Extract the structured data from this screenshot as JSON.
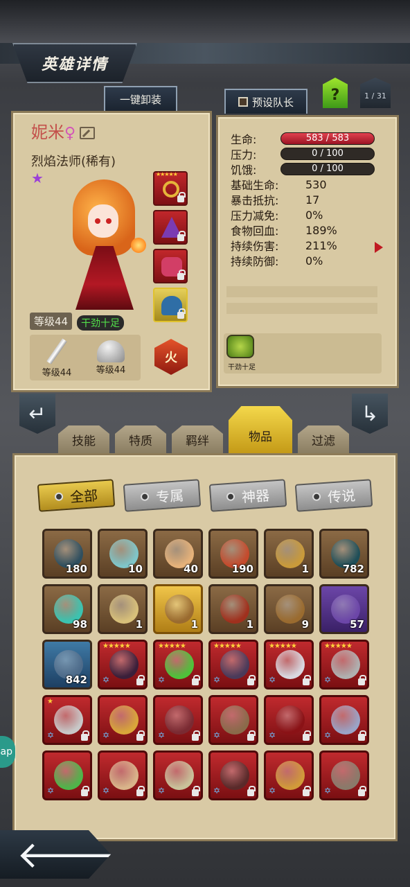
{
  "header": {
    "title": "英雄详情",
    "unequip_all": "一键卸装",
    "preset_team": "预设队长",
    "help": "?",
    "page_indicator": "1 / 31"
  },
  "hero": {
    "name": "妮米",
    "gender_symbol": "♀",
    "class": "烈焰法师(稀有)",
    "level": "等级44",
    "mood": "干劲十足",
    "weapon_level": "等级44",
    "armor_level": "等级44",
    "element": "火",
    "equip_slots": [
      {
        "icon": "ring-icon",
        "stars": "★★★★★"
      },
      {
        "icon": "wizard-hat-icon",
        "stars": ""
      },
      {
        "icon": "bracer-icon",
        "stars": ""
      },
      {
        "icon": "helmet-icon",
        "stars": ""
      }
    ]
  },
  "stats": {
    "hp_label": "生命:",
    "hp": "583 / 583",
    "stress_label": "压力:",
    "stress": "0 / 100",
    "hunger_label": "饥饿:",
    "hunger": "0 / 100",
    "rows": [
      {
        "label": "基础生命:",
        "value": "530"
      },
      {
        "label": "暴击抵抗:",
        "value": "17"
      },
      {
        "label": "压力减免:",
        "value": "0%"
      },
      {
        "label": "食物回血:",
        "value": "189%"
      },
      {
        "label": "持续伤害:",
        "value": "211%"
      },
      {
        "label": "持续防御:",
        "value": "0%"
      }
    ],
    "status_effect": "干劲十足"
  },
  "category_tabs": [
    "技能",
    "特质",
    "羁绊",
    "物品",
    "过滤"
  ],
  "active_category": "物品",
  "filters": [
    "全部",
    "专属",
    "神器",
    "传说"
  ],
  "items": [
    {
      "icon": "hero-portrait-icon",
      "count": "180",
      "frame": "brown"
    },
    {
      "icon": "elf-portrait-icon",
      "count": "10",
      "frame": "brown"
    },
    {
      "icon": "girl-portrait-icon",
      "count": "40",
      "frame": "brown"
    },
    {
      "icon": "redhair-portrait-icon",
      "count": "190",
      "frame": "brown"
    },
    {
      "icon": "scroll-icon",
      "count": "1",
      "frame": "brown"
    },
    {
      "icon": "rune-icon",
      "count": "782",
      "frame": "brown"
    },
    {
      "icon": "potion-icon",
      "count": "98",
      "frame": "brown"
    },
    {
      "icon": "amulet-icon",
      "count": "1",
      "frame": "brown"
    },
    {
      "icon": "chest-icon",
      "count": "1",
      "frame": "gold"
    },
    {
      "icon": "skull-mage-icon",
      "count": "1",
      "frame": "brown"
    },
    {
      "icon": "chest-icon",
      "count": "9",
      "frame": "brown"
    },
    {
      "icon": "chest-icon",
      "count": "57",
      "frame": "purple"
    },
    {
      "icon": "chest-icon",
      "count": "842",
      "frame": "blue"
    },
    {
      "icon": "bow-icon",
      "count": "",
      "frame": "red",
      "stars": "★★★★★"
    },
    {
      "icon": "flask-icon",
      "count": "",
      "frame": "red",
      "stars": "★★★★★"
    },
    {
      "icon": "skull-icon",
      "count": "",
      "frame": "red",
      "stars": "★★★★★"
    },
    {
      "icon": "medkit-icon",
      "count": "",
      "frame": "red",
      "stars": "★★★★★"
    },
    {
      "icon": "katana-icon",
      "count": "",
      "frame": "red",
      "stars": "★★★★★"
    },
    {
      "icon": "blade-icon",
      "count": "",
      "frame": "red",
      "stars": "★"
    },
    {
      "icon": "hood-icon",
      "count": "",
      "frame": "red",
      "stars": ""
    },
    {
      "icon": "robe-icon",
      "count": "",
      "frame": "red",
      "stars": ""
    },
    {
      "icon": "hammer-icon",
      "count": "",
      "frame": "red",
      "stars": ""
    },
    {
      "icon": "scarf-icon",
      "count": "",
      "frame": "red",
      "stars": ""
    },
    {
      "icon": "dagger-icon",
      "count": "",
      "frame": "red",
      "stars": ""
    },
    {
      "icon": "leaf-blade-icon",
      "count": "",
      "frame": "red",
      "stars": ""
    },
    {
      "icon": "horn-icon",
      "count": "",
      "frame": "red",
      "stars": ""
    },
    {
      "icon": "helm-icon",
      "count": "",
      "frame": "red",
      "stars": ""
    },
    {
      "icon": "axe-icon",
      "count": "",
      "frame": "red",
      "stars": ""
    },
    {
      "icon": "gem-ring-icon",
      "count": "",
      "frame": "red",
      "stars": ""
    },
    {
      "icon": "staff-icon",
      "count": "",
      "frame": "red",
      "stars": ""
    }
  ],
  "back_arrow": "🡐",
  "side_tab_text": "ap",
  "colors": {
    "hp_bar": "#e2414e",
    "active_tab": "#f4d84b",
    "panel": "#d8c9a3"
  }
}
